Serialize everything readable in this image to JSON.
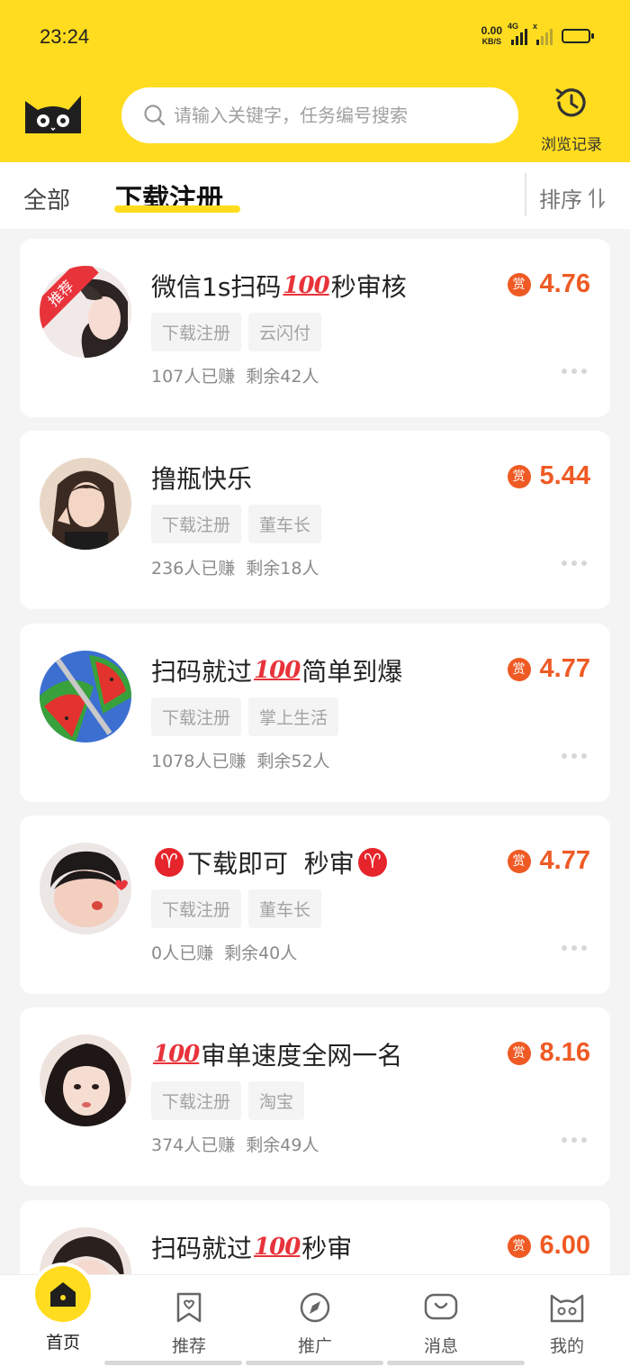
{
  "status_bar": {
    "time": "23:24",
    "net_speed": "0.00",
    "net_unit": "KB/S",
    "network": "4G",
    "signal2_icon": "x",
    "battery_icon": "battery-icon"
  },
  "header": {
    "search_placeholder": "请输入关键字，任务编号搜索",
    "history_label": "浏览记录",
    "accent_color": "#ffdc1f"
  },
  "tabs": {
    "all": "全部",
    "active": "下载注册",
    "sort": "排序"
  },
  "tasks": [
    {
      "title_parts": [
        "微信1s扫码",
        "💯",
        "秒审核"
      ],
      "tags": [
        "下载注册",
        "云闪付"
      ],
      "earned": "107人已赚",
      "remaining": "剩余42人",
      "reward_badge": "赏",
      "reward": "4.76",
      "ribbon": "推荐"
    },
    {
      "title_parts": [
        "撸瓶快乐",
        "",
        ""
      ],
      "tags": [
        "下载注册",
        "董车长"
      ],
      "earned": "236人已赚",
      "remaining": "剩余18人",
      "reward_badge": "赏",
      "reward": "5.44"
    },
    {
      "title_parts": [
        "扫码就过",
        "💯",
        "简单到爆"
      ],
      "tags": [
        "下载注册",
        "掌上生活"
      ],
      "earned": "1078人已赚",
      "remaining": "剩余52人",
      "reward_badge": "赏",
      "reward": "4.77"
    },
    {
      "title_parts": [
        "♈",
        "下载即可  秒审",
        "♈"
      ],
      "tags": [
        "下载注册",
        "董车长"
      ],
      "earned": "0人已赚",
      "remaining": "剩余40人",
      "reward_badge": "赏",
      "reward": "4.77"
    },
    {
      "title_parts": [
        "💯",
        "审单速度全网一名",
        ""
      ],
      "tags": [
        "下载注册",
        "淘宝"
      ],
      "earned": "374人已赚",
      "remaining": "剩余49人",
      "reward_badge": "赏",
      "reward": "8.16"
    },
    {
      "title_parts": [
        "扫码就过",
        "💯",
        "秒审"
      ],
      "reward_badge": "赏",
      "reward": "6.00"
    }
  ],
  "bottom_nav": {
    "home": "首页",
    "recommend": "推荐",
    "promote": "推广",
    "messages": "消息",
    "mine": "我的"
  }
}
